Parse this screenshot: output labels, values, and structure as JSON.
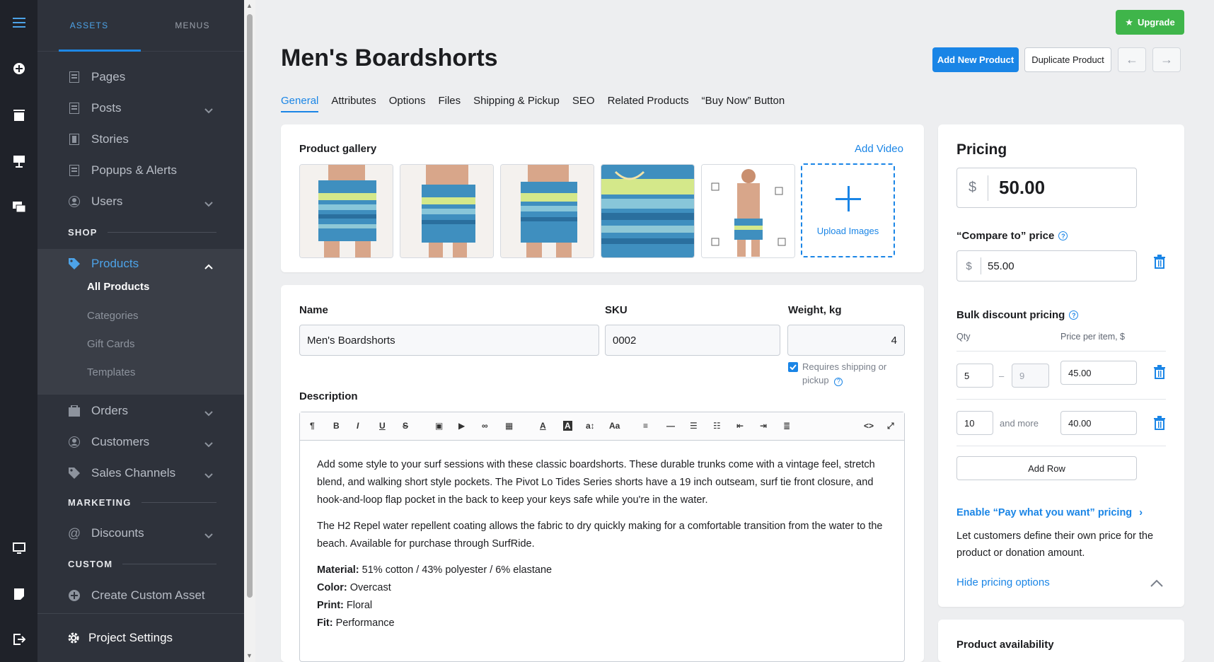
{
  "rail": {
    "icons": [
      "menu-icon",
      "add-circle-icon",
      "pages-icon",
      "design-icon",
      "chat-icon",
      "monitor-icon",
      "notes-icon",
      "logout-icon"
    ]
  },
  "sidebar": {
    "tabs": [
      {
        "label": "ASSETS"
      },
      {
        "label": "MENUS"
      }
    ],
    "items": [
      {
        "label": "Pages"
      },
      {
        "label": "Posts"
      },
      {
        "label": "Stories"
      },
      {
        "label": "Popups & Alerts"
      },
      {
        "label": "Users"
      }
    ],
    "section_shop": "SHOP",
    "products": {
      "label": "Products",
      "sub": [
        "All Products",
        "Categories",
        "Gift Cards",
        "Templates"
      ]
    },
    "items2": [
      {
        "label": "Orders"
      },
      {
        "label": "Customers"
      },
      {
        "label": "Sales Channels"
      }
    ],
    "section_marketing": "MARKETING",
    "discounts": "Discounts",
    "section_custom": "CUSTOM",
    "create_custom": "Create Custom Asset",
    "footer": "Project Settings"
  },
  "header": {
    "title": "Men's Boardshorts",
    "add_new": "Add New Product",
    "duplicate": "Duplicate Product",
    "upgrade": "Upgrade",
    "prev": "←",
    "next": "→"
  },
  "tabs": [
    "General",
    "Attributes",
    "Options",
    "Files",
    "Shipping & Pickup",
    "SEO",
    "Related Products",
    "“Buy Now” Button"
  ],
  "gallery": {
    "label": "Product gallery",
    "add_video": "Add Video",
    "upload": "Upload Images"
  },
  "form": {
    "name_label": "Name",
    "name_value": "Men's Boardshorts",
    "sku_label": "SKU",
    "sku_value": "0002",
    "weight_label": "Weight, kg",
    "weight_value": "4",
    "requires_shipping": "Requires shipping or pickup",
    "description_label": "Description"
  },
  "description": {
    "p1": "Add some style to your surf sessions with these classic boardshorts. These durable trunks come with a vintage feel, stretch blend, and walking short style pockets. The Pivot Lo Tides Series shorts have a 19 inch outseam, surf tie front closure, and hook-and-loop flap pocket in the back to keep your keys safe while you're in the water.",
    "p2": "The H2 Repel water repellent coating allows the fabric to dry quickly making for a comfortable transition from the water to the beach. Available for purchase through SurfRide.",
    "material_k": "Material:",
    "material_v": " 51% cotton / 43% polyester / 6% elastane",
    "color_k": "Color:",
    "color_v": " Overcast",
    "print_k": "Print:",
    "print_v": " Floral",
    "fit_k": "Fit:",
    "fit_v": " Performance"
  },
  "pricing": {
    "title": "Pricing",
    "currency": "$",
    "price": "50.00",
    "compare_label": "“Compare to” price",
    "compare_value": "55.00",
    "bulk_label": "Bulk discount pricing",
    "qty_col": "Qty",
    "price_col": "Price per item, $",
    "row1_from": "5",
    "row1_dash": "–",
    "row1_to": "9",
    "row1_price": "45.00",
    "row2_from": "10",
    "row2_more": "and more",
    "row2_price": "40.00",
    "add_row": "Add Row",
    "pwyw_link": "Enable “Pay what you want” pricing",
    "pwyw_desc": "Let customers define their own price for the product or donation amount.",
    "hide": "Hide pricing options"
  },
  "availability": {
    "title": "Product availability"
  },
  "colors": {
    "accent": "#1a85e6",
    "sidebar": "#2e323b",
    "rail": "#1f2229",
    "upgrade": "#3fb54a"
  }
}
